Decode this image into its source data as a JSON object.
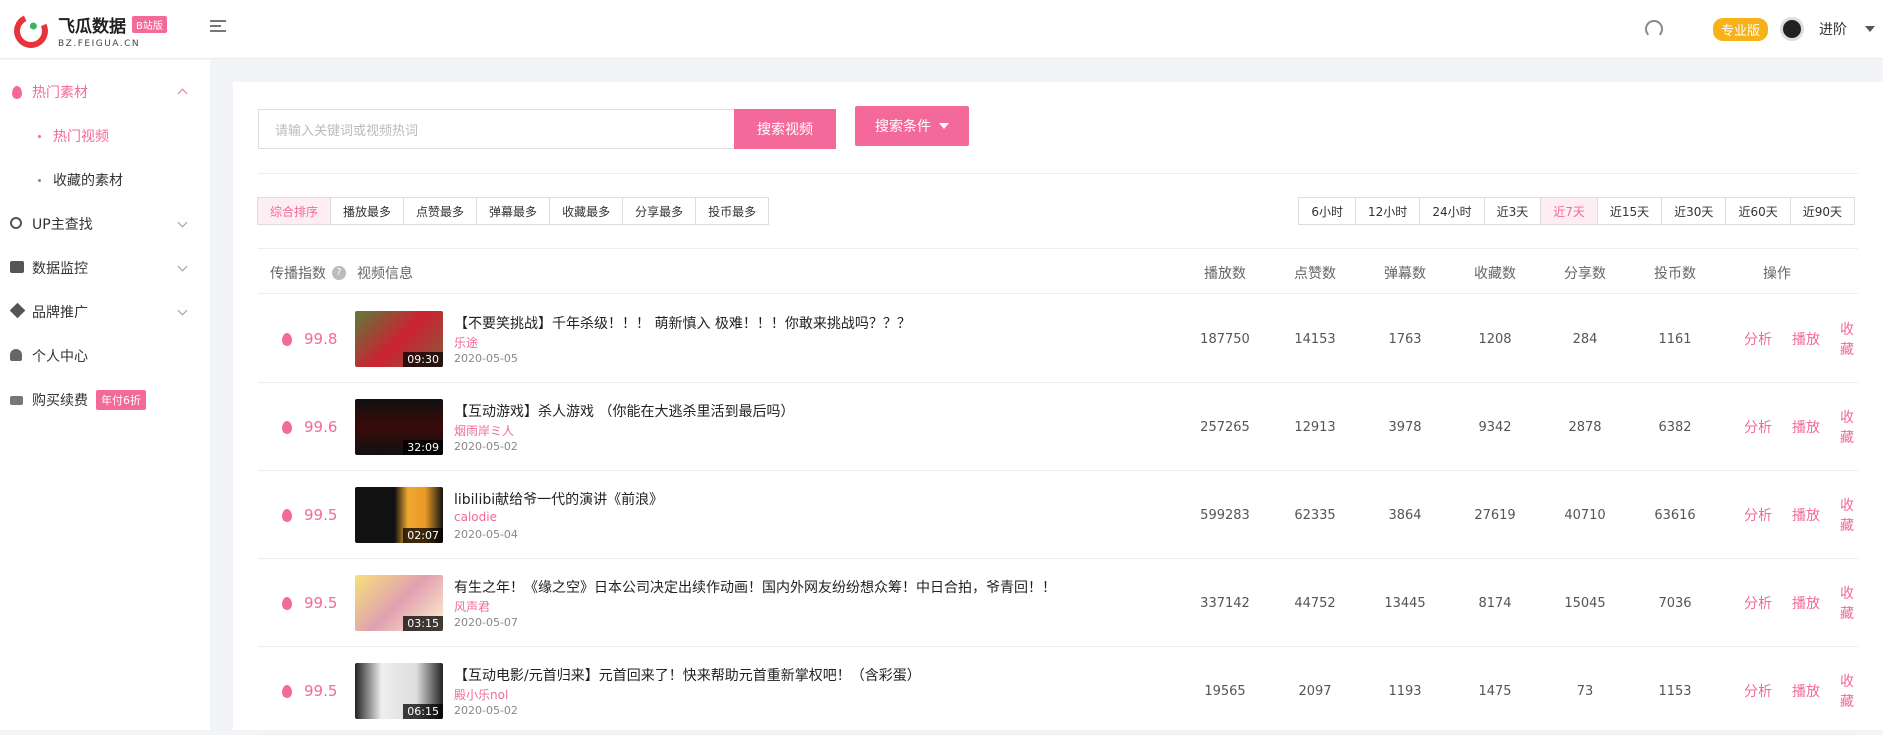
{
  "header": {
    "logo_title": "飞瓜数据",
    "logo_badge": "B站版",
    "logo_sub": "BZ.FEIGUA.CN",
    "pro_badge": "专业版",
    "user_label": "进阶"
  },
  "sidebar": {
    "items": [
      {
        "label": "热门素材",
        "icon": "flame-icon"
      },
      {
        "label": "热门视频"
      },
      {
        "label": "收藏的素材"
      },
      {
        "label": "UP主查找",
        "icon": "search-icon"
      },
      {
        "label": "数据监控",
        "icon": "chart-icon"
      },
      {
        "label": "品牌推广",
        "icon": "diamond-icon"
      },
      {
        "label": "个人中心",
        "icon": "user-icon"
      },
      {
        "label": "购买续费",
        "icon": "card-icon",
        "badge": "年付6折"
      }
    ]
  },
  "search": {
    "placeholder": "请输入关键词或视频热词",
    "button": "搜索视频",
    "condition_button": "搜索条件"
  },
  "sort_tabs": [
    "综合排序",
    "播放最多",
    "点赞最多",
    "弹幕最多",
    "收藏最多",
    "分享最多",
    "投币最多"
  ],
  "time_tabs": [
    "6小时",
    "12小时",
    "24小时",
    "近3天",
    "近7天",
    "近15天",
    "近30天",
    "近60天",
    "近90天"
  ],
  "table": {
    "headers": {
      "index": "传播指数",
      "info": "视频信息",
      "plays": "播放数",
      "likes": "点赞数",
      "danmaku": "弹幕数",
      "favorites": "收藏数",
      "shares": "分享数",
      "coins": "投币数",
      "actions": "操作"
    },
    "action_labels": {
      "analyze": "分析",
      "play": "播放",
      "favorite": "收藏"
    },
    "rows": [
      {
        "score": "99.8",
        "duration": "09:30",
        "title": "【不要笑挑战】千年杀级！！！ 萌新慎入 极难！！！你敢来挑战吗？？？",
        "author": "乐途",
        "date": "2020-05-05",
        "plays": "187750",
        "likes": "14153",
        "danmaku": "1763",
        "favorites": "1208",
        "shares": "284",
        "coins": "1161"
      },
      {
        "score": "99.6",
        "duration": "32:09",
        "title": "【互动游戏】杀人游戏 （你能在大逃杀里活到最后吗）",
        "author": "烟雨岸ミ人",
        "date": "2020-05-02",
        "plays": "257265",
        "likes": "12913",
        "danmaku": "3978",
        "favorites": "9342",
        "shares": "2878",
        "coins": "6382"
      },
      {
        "score": "99.5",
        "duration": "02:07",
        "title": "libilibi献给爷一代的演讲《前浪》",
        "author": "calodie",
        "date": "2020-05-04",
        "plays": "599283",
        "likes": "62335",
        "danmaku": "3864",
        "favorites": "27619",
        "shares": "40710",
        "coins": "63616"
      },
      {
        "score": "99.5",
        "duration": "03:15",
        "title": "有生之年！《缘之空》日本公司决定出续作动画！国内外网友纷纷想众筹！中日合拍，爷青回！！",
        "author": "风声君",
        "date": "2020-05-07",
        "plays": "337142",
        "likes": "44752",
        "danmaku": "13445",
        "favorites": "8174",
        "shares": "15045",
        "coins": "7036"
      },
      {
        "score": "99.5",
        "duration": "06:15",
        "title": "【互动电影/元首归来】元首回来了！快来帮助元首重新掌权吧！（含彩蛋）",
        "author": "殿小乐nol",
        "date": "2020-05-02",
        "plays": "19565",
        "likes": "2097",
        "danmaku": "1193",
        "favorites": "1475",
        "shares": "73",
        "coins": "1153"
      }
    ]
  },
  "colors": {
    "accent": "#f36a9a",
    "badge": "#f7b21a"
  }
}
